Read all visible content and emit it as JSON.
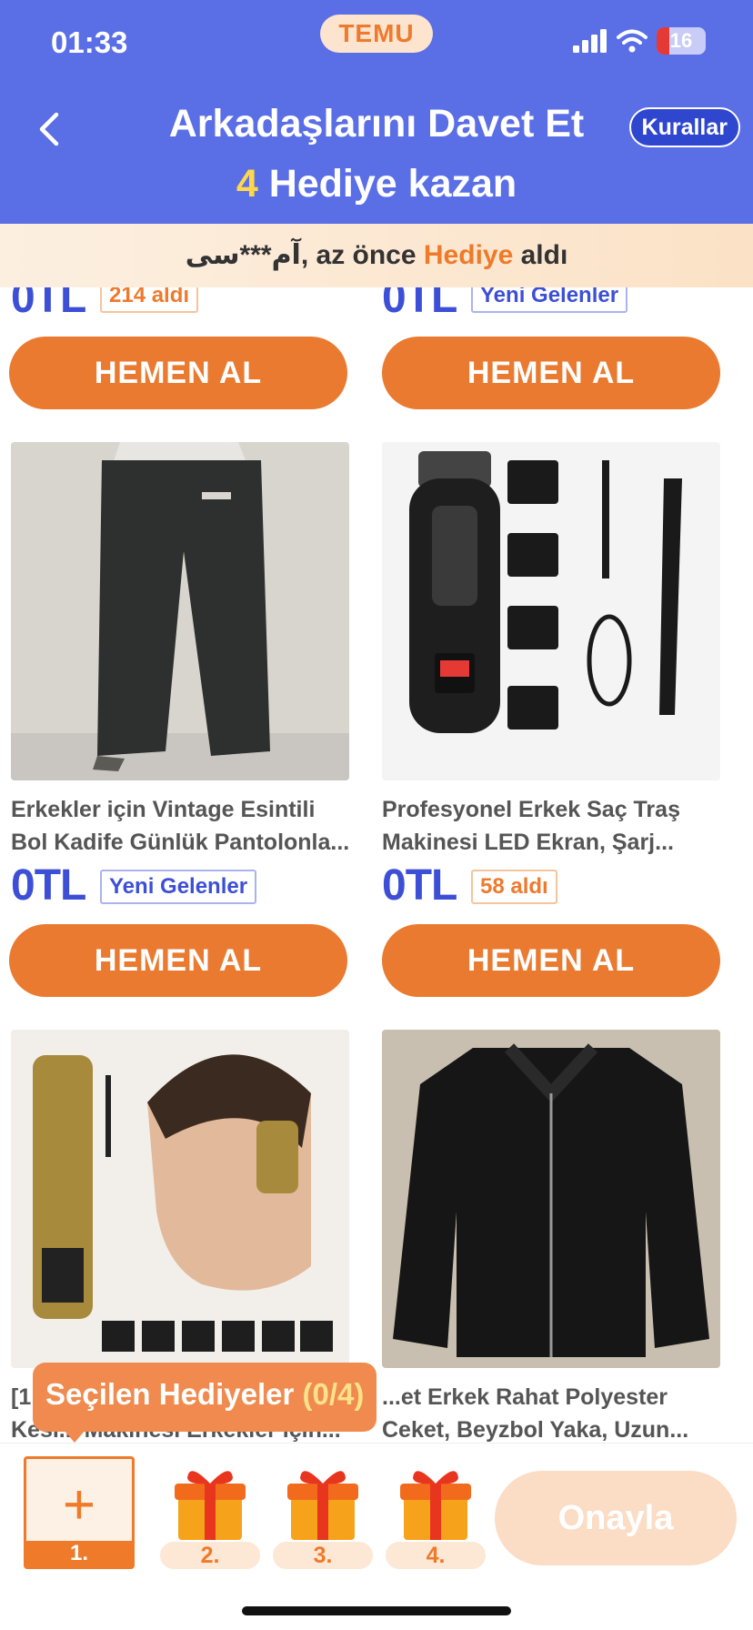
{
  "status_bar": {
    "time": "01:33",
    "app_badge": "TEMU",
    "battery": "16"
  },
  "header": {
    "title": "Arkadaşlarını Davet Et",
    "subtitle_number": "4",
    "subtitle_text": " Hediye kazan",
    "rules_label": "Kurallar"
  },
  "ticker": {
    "user": "آم***سی",
    "prefix": ", az önce ",
    "highlight": "Hediye",
    "suffix": " aldı"
  },
  "products": [
    {
      "price": "0TL",
      "badge": "214 aldı",
      "badge_style": "orange",
      "button": "HEMEN AL"
    },
    {
      "price": "0TL",
      "badge": "Yeni Gelenler",
      "badge_style": "blue",
      "button": "HEMEN AL"
    },
    {
      "title1": "Erkekler için Vintage Esintili",
      "title2": "Bol Kadife Günlük Pantolonla...",
      "price": "0TL",
      "badge": "Yeni Gelenler",
      "badge_style": "blue",
      "button": "HEMEN AL"
    },
    {
      "title1": "Profesyonel Erkek Saç Traş",
      "title2": "Makinesi LED Ekran, Şarj...",
      "price": "0TL",
      "badge": "58 aldı",
      "badge_style": "orange",
      "button": "HEMEN AL"
    },
    {
      "title1": "[1",
      "title2": "Kesi... Makinesi Erkekler için..."
    },
    {
      "title1": "...et Erkek Rahat Polyester",
      "title2": "Ceket, Beyzbol Yaka, Uzun..."
    }
  ],
  "gift_bar": {
    "tooltip_label": "Seçilen Hediyeler ",
    "tooltip_count": "(0/4)",
    "slots": [
      "1.",
      "2.",
      "3.",
      "4."
    ],
    "confirm_label": "Onayla"
  },
  "icons": {
    "back": "chevron-left-icon",
    "signal": "signal-icon",
    "wifi": "wifi-icon",
    "battery": "battery-icon",
    "plus": "plus-icon",
    "gift": "gift-box-icon"
  },
  "colors": {
    "header_bg": "#5a6ee6",
    "accent_orange": "#ea7a2f",
    "price_blue": "#3d4fd6",
    "number_yellow": "#ffd84a"
  }
}
